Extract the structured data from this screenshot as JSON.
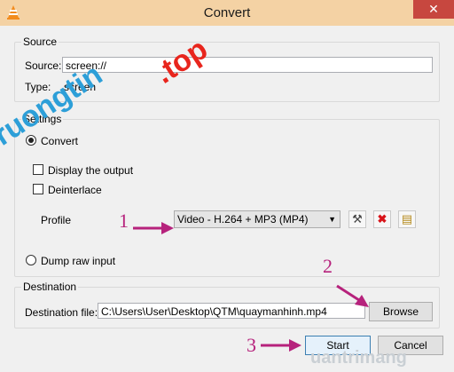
{
  "window": {
    "title": "Convert",
    "close_glyph": "✕",
    "icon": "vlc-cone-icon"
  },
  "source": {
    "group_label": "Source",
    "source_label": "Source:",
    "source_value": "screen://",
    "type_label": "Type:",
    "type_value": "screen"
  },
  "settings": {
    "group_label": "Settings",
    "convert_label": "Convert",
    "convert_checked": true,
    "display_output_label": "Display the output",
    "deinterlace_label": "Deinterlace",
    "profile_label": "Profile",
    "profile_value": "Video - H.264 + MP3 (MP4)",
    "profile_tools": [
      "wrench-screwdriver-icon",
      "delete-x-icon",
      "new-profile-icon"
    ],
    "dump_raw_label": "Dump raw input"
  },
  "destination": {
    "group_label": "Destination",
    "file_label": "Destination file:",
    "file_value": "C:\\Users\\User\\Desktop\\QTM\\quaymanhinh.mp4",
    "browse_label": "Browse"
  },
  "footer": {
    "start_label": "Start",
    "cancel_label": "Cancel"
  },
  "annotations": {
    "step1": "1",
    "step2": "2",
    "step3": "3",
    "arrow_color": "#b6227c"
  },
  "watermark": {
    "text_red": ".top",
    "text_blue": "Truongtin",
    "bottom_text": "uantrimang",
    "red": "#e8251d",
    "blue": "#2d9fd8"
  }
}
